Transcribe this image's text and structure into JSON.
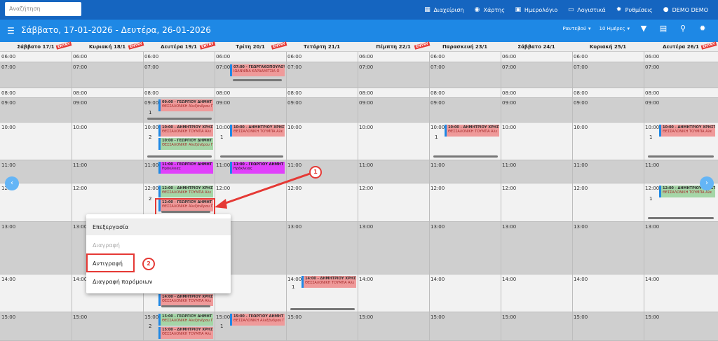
{
  "search": {
    "placeholder": "Αναζήτηση"
  },
  "topnav": [
    {
      "label": "Διαχείριση",
      "icon": "dashboard-icon"
    },
    {
      "label": "Χάρτης",
      "icon": "globe-icon"
    },
    {
      "label": "Ημερολόγιο",
      "icon": "calendar-icon"
    },
    {
      "label": "Λογιστικά",
      "icon": "money-icon"
    },
    {
      "label": "Ρυθμίσεις",
      "icon": "gear-icon"
    },
    {
      "label": "DEMO DEMO",
      "icon": "user-icon"
    }
  ],
  "toolbar": {
    "title": "Σάββατο, 17-01-2026 - Δευτέρα, 26-01-2026",
    "type_select": "Ραντεβού",
    "range_select": "10 Ημέρες"
  },
  "days": [
    {
      "label": "Σάββατο 17/1",
      "entry": true
    },
    {
      "label": "Κυριακή 18/1",
      "entry": true
    },
    {
      "label": "Δευτέρα 19/1",
      "entry": true
    },
    {
      "label": "Τρίτη 20/1",
      "entry": true
    },
    {
      "label": "Τετάρτη 21/1",
      "entry": false
    },
    {
      "label": "Πέμπτη 22/1",
      "entry": true
    },
    {
      "label": "Παρασκευή 23/1",
      "entry": false
    },
    {
      "label": "Σάββατο 24/1",
      "entry": false
    },
    {
      "label": "Κυριακή 25/1",
      "entry": false
    },
    {
      "label": "Δευτέρα 26/1",
      "entry": true
    }
  ],
  "entry_label": "ENTRY",
  "times": [
    "06:00",
    "07:00",
    "08:00",
    "09:00",
    "10:00",
    "11:00",
    "12:00",
    "13:00",
    "14:00",
    "15:00"
  ],
  "events": [
    {
      "t1": "07:00 - ΓΕΩΡΓΑΚΟΠΟΥΛΟΥ",
      "t2": "ΙΩΑΝΝΙΝΑ ΚΑΡΔΑΜΙΤΣΙΑ Ο"
    },
    {
      "t1": "09:00 - ΓΕΩΡΓΙΟΥ ΔΗΜΗΤ",
      "t2": "ΘΕΣΣΑΛΟΝΙΚΗ Αλεξάνδρου Γ"
    },
    {
      "t1": "10:00 - ΔΗΜΗΤΡΙΟΥ ΧΡΗΣΤ",
      "t2": "ΘΕΣΣΑΛΟΝΙΚΗ ΤΟΥΜΠΑ Αλε"
    },
    {
      "t1": "10:00 - ΓΕΩΡΓΙΟΥ ΔΗΜΗΤ",
      "t2": "ΘΕΣΣΑΛΟΝΙΚΗ Αλεξάνδρου Γ"
    },
    {
      "t1": "10:00 - ΔΗΜΗΤΡΙΟΥ ΧΡΗΣΤ",
      "t2": "ΘΕΣΣΑΛΟΝΙΚΗ ΤΟΥΜΠΑ Αλε"
    },
    {
      "t1": "11:00 - ΓΕΩΡΓΙΟΥ ΔΗΜΗΤ",
      "t2": "Ηράκλειας"
    },
    {
      "t1": "12:00 - ΔΗΜΗΤΡΙΟΥ ΧΡΗΣΤ",
      "t2": "ΘΕΣΣΑΛΟΝΙΚΗ ΤΟΥΜΠΑ Αλε"
    },
    {
      "t1": "12:00 - ΓΕΩΡΓΙΟΥ ΔΗΜΗΤ",
      "t2": "ΘΕΣΣΑΛΟΝΙΚΗ Αλεξάνδρου Γ"
    },
    {
      "t1": "14:00 - ΔΗΜΗΤΡΙΟΥ ΧΡΗΣΤ",
      "t2": "ΘΕΣΣΑΛΟΝΙΚΗ ΤΟΥΜΠΑ Αλε"
    },
    {
      "t1": "15:00 - ΓΕΩΡΓΙΟΥ ΔΗΜΗΤ",
      "t2": "ΘΕΣΣΑΛΟΝΙΚΗ Αλεξάνδρου Γ"
    },
    {
      "t1": "15:00 - ΔΗΜΗΤΡΙΟΥ ΧΡΗΣΤ",
      "t2": "ΘΕΣΣΑΛΟΝΙΚΗ ΤΟΥΜΠΑ Αλε"
    }
  ],
  "counts": {
    "one": "1",
    "two": "2"
  },
  "context_menu": [
    {
      "label": "Επεξεργασία"
    },
    {
      "label": "Διαγραφή"
    },
    {
      "label": "Αντιγραφή"
    },
    {
      "label": "Διαγραφή παρόμοιων"
    }
  ],
  "callouts": [
    "1",
    "2"
  ]
}
